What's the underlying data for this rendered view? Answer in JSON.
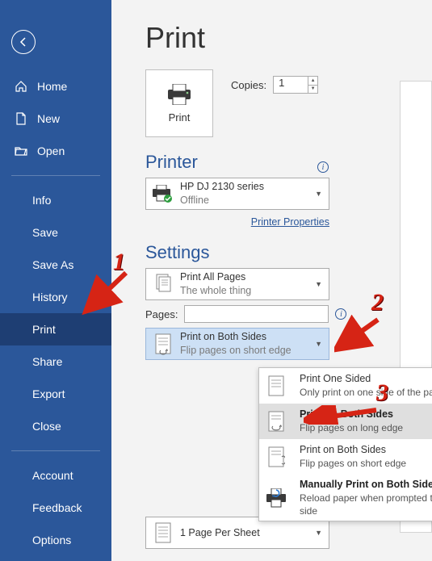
{
  "sidebar": {
    "items": [
      {
        "label": "Home",
        "icon": "home"
      },
      {
        "label": "New",
        "icon": "doc"
      },
      {
        "label": "Open",
        "icon": "folder"
      }
    ],
    "file_items": [
      "Info",
      "Save",
      "Save As",
      "History",
      "Print",
      "Share",
      "Export",
      "Close"
    ],
    "active_index": 4,
    "bottom_items": [
      "Account",
      "Feedback",
      "Options"
    ]
  },
  "page_title": "Print",
  "print_button_label": "Print",
  "copies": {
    "label": "Copies:",
    "value": "1"
  },
  "printer_section": {
    "title": "Printer",
    "name": "HP DJ 2130 series",
    "status": "Offline",
    "link": "Printer Properties"
  },
  "settings_section": {
    "title": "Settings"
  },
  "print_what": {
    "title": "Print All Pages",
    "sub": "The whole thing"
  },
  "pages": {
    "label": "Pages:",
    "value": ""
  },
  "duplex_selected": {
    "title": "Print on Both Sides",
    "sub": "Flip pages on short edge"
  },
  "duplex_options": [
    {
      "title": "Print One Sided",
      "sub": "Only print on one side of the page",
      "bold": false
    },
    {
      "title": "Print on Both Sides",
      "sub": "Flip pages on long edge",
      "bold": true
    },
    {
      "title": "Print on Both Sides",
      "sub": "Flip pages on short edge",
      "bold": false
    },
    {
      "title": "Manually Print on Both Sides",
      "sub": "Reload paper when prompted to print the second side",
      "bold": true
    }
  ],
  "pages_per_sheet": {
    "title": "1 Page Per Sheet"
  },
  "annotations": {
    "n1": "1",
    "n2": "2",
    "n3": "3"
  }
}
